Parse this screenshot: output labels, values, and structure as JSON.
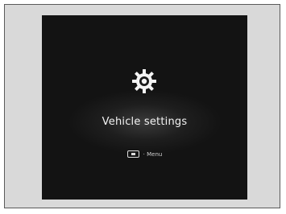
{
  "screen": {
    "title": "Vehicle settings",
    "icon": "gear-icon",
    "hint": {
      "button_icon": "menu-button-icon",
      "label": "· Menu"
    }
  },
  "colors": {
    "frame_background": "#d9d9d9",
    "screen_background": "#131313",
    "text": "#f2f2f2"
  }
}
